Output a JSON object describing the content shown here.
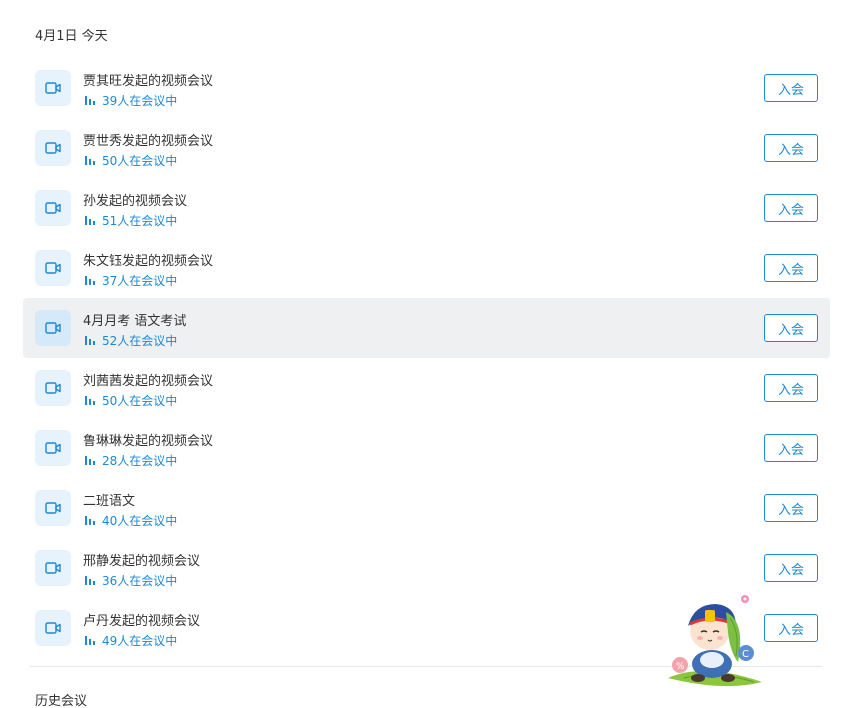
{
  "today_label": "4月1日 今天",
  "history_label": "历史会议",
  "join_label": "入会",
  "meetings": [
    {
      "title": "贾其旺发起的视频会议",
      "status": "39人在会议中"
    },
    {
      "title": "贾世秀发起的视频会议",
      "status": "50人在会议中"
    },
    {
      "title": "孙发起的视频会议",
      "status": "51人在会议中"
    },
    {
      "title": "朱文钰发起的视频会议",
      "status": "37人在会议中"
    },
    {
      "title": "4月月考 语文考试",
      "status": "52人在会议中"
    },
    {
      "title": "刘茜茜发起的视频会议",
      "status": "50人在会议中"
    },
    {
      "title": "鲁琳琳发起的视频会议",
      "status": "28人在会议中"
    },
    {
      "title": "二班语文",
      "status": "40人在会议中"
    },
    {
      "title": "邢静发起的视频会议",
      "status": "36人在会议中"
    },
    {
      "title": "卢丹发起的视频会议",
      "status": "49人在会议中"
    }
  ],
  "colors": {
    "accent": "#1e88d4",
    "icon_bg": "#e6f3fc",
    "highlight_bg": "#eef0f2"
  },
  "icons": {
    "meeting": "video-camera-icon",
    "status": "signal-bars-icon",
    "mascot": "cartoon-mascot"
  },
  "highlighted_index": 4
}
